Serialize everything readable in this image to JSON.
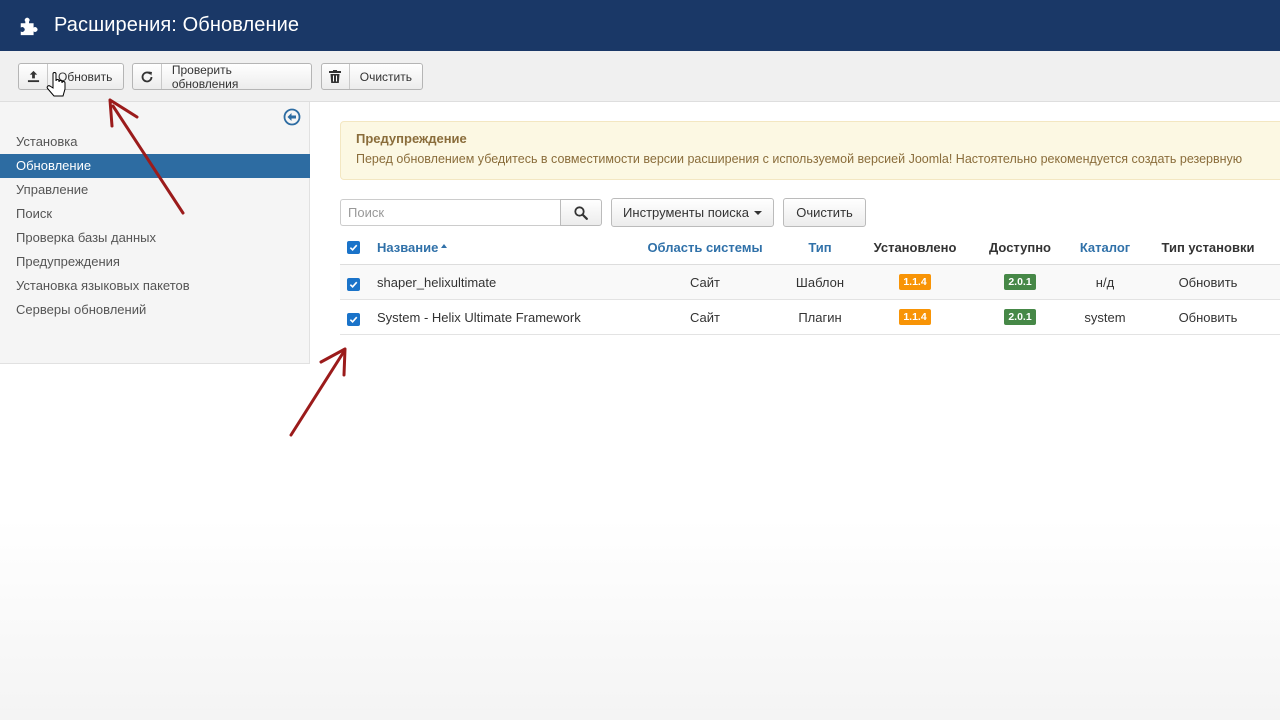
{
  "header": {
    "title": "Расширения: Обновление",
    "icon": "puzzle-icon"
  },
  "toolbar": {
    "update_label": "Обновить",
    "check_label": "Проверить обновления",
    "clear_label": "Очистить"
  },
  "sidebar": {
    "items": [
      {
        "label": "Установка"
      },
      {
        "label": "Обновление",
        "active": true
      },
      {
        "label": "Управление"
      },
      {
        "label": "Поиск"
      },
      {
        "label": "Проверка базы данных"
      },
      {
        "label": "Предупреждения"
      },
      {
        "label": "Установка языковых пакетов"
      },
      {
        "label": "Серверы обновлений"
      }
    ]
  },
  "alert": {
    "heading": "Предупреждение",
    "body": "Перед обновлением убедитесь в совместимости версии расширения с используемой версией Joomla! Настоятельно рекомендуется создать резервную"
  },
  "search": {
    "placeholder": "Поиск",
    "tools_label": "Инструменты поиска",
    "clear_label": "Очистить"
  },
  "table": {
    "columns": {
      "name": "Название",
      "area": "Область системы",
      "type": "Тип",
      "installed": "Установлено",
      "available": "Доступно",
      "folder": "Каталог",
      "install_type": "Тип установки"
    },
    "rows": [
      {
        "name": "shaper_helixultimate",
        "area": "Сайт",
        "type": "Шаблон",
        "installed": "1.1.4",
        "available": "2.0.1",
        "folder": "н/д",
        "install_type": "Обновить",
        "checked": true
      },
      {
        "name": "System - Helix Ultimate Framework",
        "area": "Сайт",
        "type": "Плагин",
        "installed": "1.1.4",
        "available": "2.0.1",
        "folder": "system",
        "install_type": "Обновить",
        "checked": true
      }
    ]
  },
  "colors": {
    "header_bg": "#1a3867",
    "active_item": "#2d6ca2",
    "link": "#3071a9",
    "badge_installed": "#f89406",
    "badge_available": "#468847",
    "alert_bg": "#fcf8e3",
    "arrow": "#9b1b1b"
  }
}
